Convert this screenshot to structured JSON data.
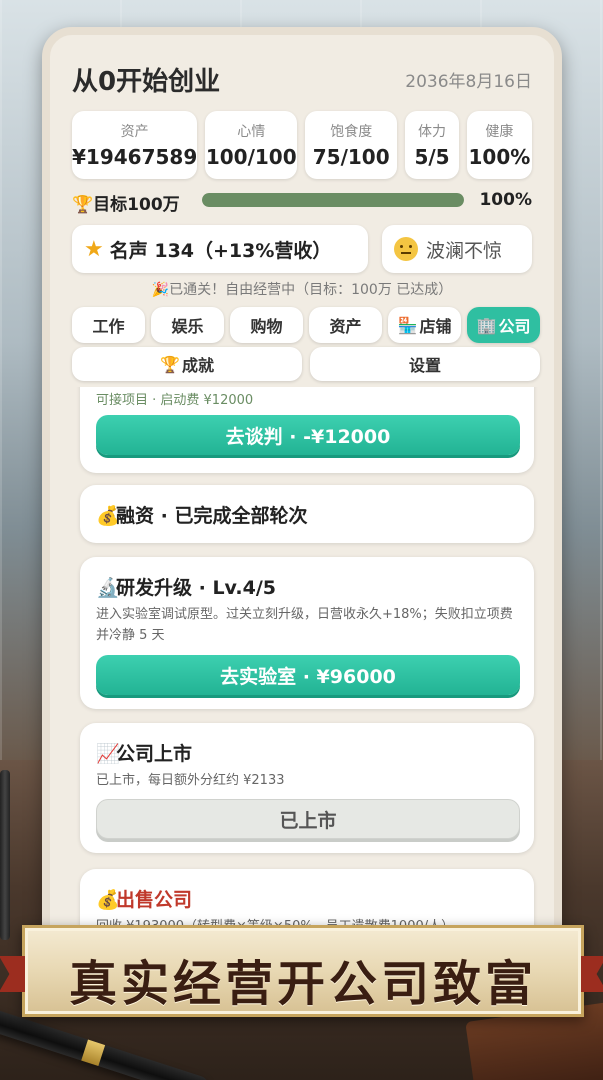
{
  "app": {
    "title": "从0开始创业",
    "date": "2036年8月16日"
  },
  "stats": [
    {
      "label": "资产",
      "value": "¥19467589"
    },
    {
      "label": "心情",
      "value": "100/100"
    },
    {
      "label": "饱食度",
      "value": "75/100"
    },
    {
      "label": "体力",
      "value": "5/5"
    },
    {
      "label": "健康",
      "value": "100%"
    }
  ],
  "goal": {
    "label": "目标100万",
    "percent_text": "100%",
    "progress": 1.0
  },
  "fame": {
    "text": "名声 134（+13%营收）"
  },
  "mood": {
    "text": "波澜不惊"
  },
  "cleared_text": "🎉已通关！自由经营中（目标：100万 已达成）",
  "tabs": [
    "工作",
    "娱乐",
    "购物",
    "资产",
    "店铺",
    "公司"
  ],
  "tabs2": [
    "成就",
    "设置"
  ],
  "cards": {
    "negotiate": {
      "desc": "可接项目 · 启动费 ¥12000",
      "button": "去谈判 · -¥12000"
    },
    "financing": {
      "title": "融资 · 已完成全部轮次"
    },
    "rnd": {
      "title": "研发升级 · Lv.4/5",
      "desc": "进入实验室调试原型。过关立刻升级，日营收永久+18%；失败扣立项费并冷静 5 天",
      "button": "去实验室 · ¥96000"
    },
    "ipo": {
      "title": "公司上市",
      "desc": "已上市，每日额外分红约 ¥2133",
      "button": "已上市"
    },
    "sell": {
      "title": "出售公司",
      "desc": "回收 ¥193000（转型费×等级×50% - 员工遣散费1000/人）"
    }
  },
  "banner": {
    "text": "真实经营开公司致富"
  },
  "colors": {
    "accent": "#2fbfa1",
    "progress": "#6a8d63",
    "sell_title": "#c0392b"
  }
}
